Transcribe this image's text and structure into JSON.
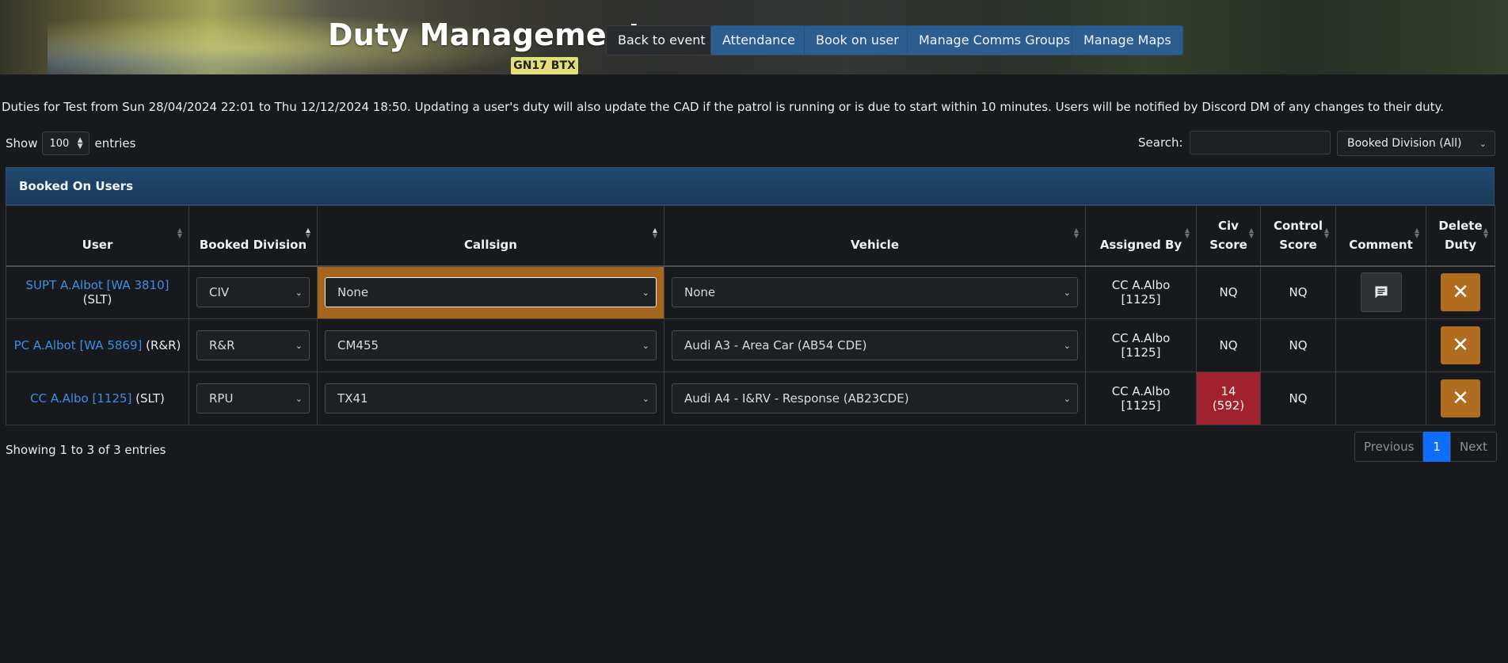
{
  "header": {
    "title": "Duty Management",
    "plate_text": "GN17 BTX",
    "buttons": {
      "back": "Back to event",
      "attendance": "Attendance",
      "book_on": "Book on user",
      "comms": "Manage Comms Groups",
      "maps": "Manage Maps"
    }
  },
  "description": "Duties for Test from Sun 28/04/2024 22:01 to Thu 12/12/2024 18:50. Updating a user's duty will also update the CAD if the patrol is running or is due to start within 10 minutes. Users will be notified by Discord DM of any changes to their duty.",
  "controls": {
    "show_label": "Show",
    "entries_value": "100",
    "entries_label": "entries",
    "search_label": "Search:",
    "search_value": "",
    "division_filter": "Booked Division (All)"
  },
  "panel_title": "Booked On Users",
  "table": {
    "headers": {
      "user": "User",
      "division": "Booked Division",
      "callsign": "Callsign",
      "vehicle": "Vehicle",
      "assigned": "Assigned By",
      "civ": "Civ Score",
      "control": "Control Score",
      "comment": "Comment",
      "delete": "Delete Duty"
    },
    "rows": [
      {
        "user_link": "SUPT A.Albot [WA 3810]",
        "user_suffix": "(SLT)",
        "division": "CIV",
        "callsign": "None",
        "vehicle": "None",
        "assigned_by": "CC A.Albo [1125]",
        "civ_score": "NQ",
        "control_score": "NQ"
      },
      {
        "user_link": "PC A.Albot [WA 5869]",
        "user_suffix": "(R&R)",
        "division": "R&R",
        "callsign": "CM455",
        "vehicle": "Audi A3 - Area Car (AB54 CDE)",
        "assigned_by": "CC A.Albo [1125]",
        "civ_score": "NQ",
        "control_score": "NQ"
      },
      {
        "user_link": "CC A.Albo [1125]",
        "user_suffix": "(SLT)",
        "division": "RPU",
        "callsign": "TX41",
        "vehicle": "Audi A4 - I&RV - Response (AB23CDE)",
        "assigned_by": "CC A.Albo [1125]",
        "civ_score": "14 (592)",
        "control_score": "NQ"
      }
    ]
  },
  "footer": {
    "info": "Showing 1 to 3 of 3 entries",
    "previous": "Previous",
    "page": "1",
    "next": "Next"
  },
  "colors": {
    "background": "#18191c",
    "button_blue": "#2b5d8e",
    "link": "#3a8fe8",
    "highlight_orange": "#a5651c",
    "score_red": "#a1222f",
    "delete_orange": "#b06c1f",
    "active_page": "#0d6efd"
  },
  "icons": {
    "comment": "comment-icon",
    "delete": "close-icon"
  }
}
